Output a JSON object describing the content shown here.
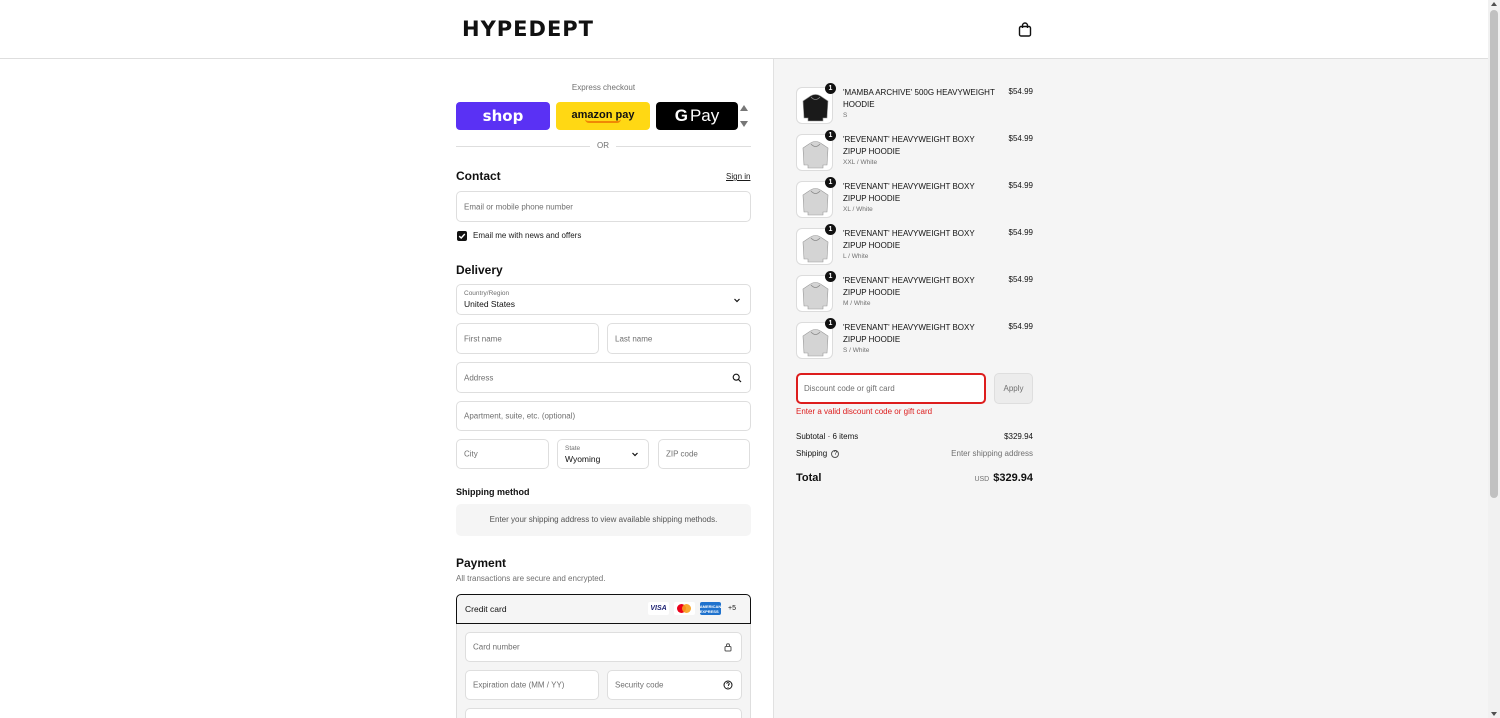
{
  "header": {
    "logo": "HYPEDEPT",
    "cart_icon": "shopping-bag-icon"
  },
  "express": {
    "label": "Express checkout",
    "shop_label": "shop",
    "amazon_label": "amazon pay",
    "gpay_g": "G",
    "gpay_label": "Pay",
    "or_label": "OR"
  },
  "contact": {
    "title": "Contact",
    "sign_in": "Sign in",
    "email_placeholder": "Email or mobile phone number",
    "newsletter_label": "Email me with news and offers",
    "newsletter_checked": true
  },
  "delivery": {
    "title": "Delivery",
    "country_label": "Country/Region",
    "country_value": "United States",
    "first_name_placeholder": "First name",
    "last_name_placeholder": "Last name",
    "address_placeholder": "Address",
    "apartment_placeholder": "Apartment, suite, etc. (optional)",
    "city_placeholder": "City",
    "state_label": "State",
    "state_value": "Wyoming",
    "zip_placeholder": "ZIP code"
  },
  "shipping": {
    "title": "Shipping method",
    "message": "Enter your shipping address to view available shipping methods."
  },
  "payment": {
    "title": "Payment",
    "subtitle": "All transactions are secure and encrypted.",
    "method_label": "Credit card",
    "visa_label": "VISA",
    "amex_label": "AMERICAN EXPRESS",
    "more_cards": "+5",
    "card_number_placeholder": "Card number",
    "expiration_placeholder": "Expiration date (MM / YY)",
    "security_placeholder": "Security code"
  },
  "cart": {
    "items": [
      {
        "qty": "1",
        "name": "'MAMBA ARCHIVE' 500G HEAVYWEIGHT HOODIE",
        "variant": "S",
        "price": "$54.99",
        "color": "#1a1a1a"
      },
      {
        "qty": "1",
        "name": "'REVENANT' HEAVYWEIGHT BOXY ZIPUP HOODIE",
        "variant": "XXL / White",
        "price": "$54.99",
        "color": "#d4d4d4"
      },
      {
        "qty": "1",
        "name": "'REVENANT' HEAVYWEIGHT BOXY ZIPUP HOODIE",
        "variant": "XL / White",
        "price": "$54.99",
        "color": "#d4d4d4"
      },
      {
        "qty": "1",
        "name": "'REVENANT' HEAVYWEIGHT BOXY ZIPUP HOODIE",
        "variant": "L / White",
        "price": "$54.99",
        "color": "#d4d4d4"
      },
      {
        "qty": "1",
        "name": "'REVENANT' HEAVYWEIGHT BOXY ZIPUP HOODIE",
        "variant": "M / White",
        "price": "$54.99",
        "color": "#d4d4d4"
      },
      {
        "qty": "1",
        "name": "'REVENANT' HEAVYWEIGHT BOXY ZIPUP HOODIE",
        "variant": "S / White",
        "price": "$54.99",
        "color": "#d4d4d4"
      }
    ],
    "discount_placeholder": "Discount code or gift card",
    "apply_label": "Apply",
    "discount_error": "Enter a valid discount code or gift card",
    "subtotal_label": "Subtotal · 6 items",
    "subtotal_value": "$329.94",
    "shipping_label": "Shipping",
    "shipping_value": "Enter shipping address",
    "total_label": "Total",
    "total_currency": "USD",
    "total_value": "$329.94"
  },
  "colors": {
    "shop": "#5a31f4",
    "amazon": "#ffd814",
    "error": "#dd1d1d"
  }
}
